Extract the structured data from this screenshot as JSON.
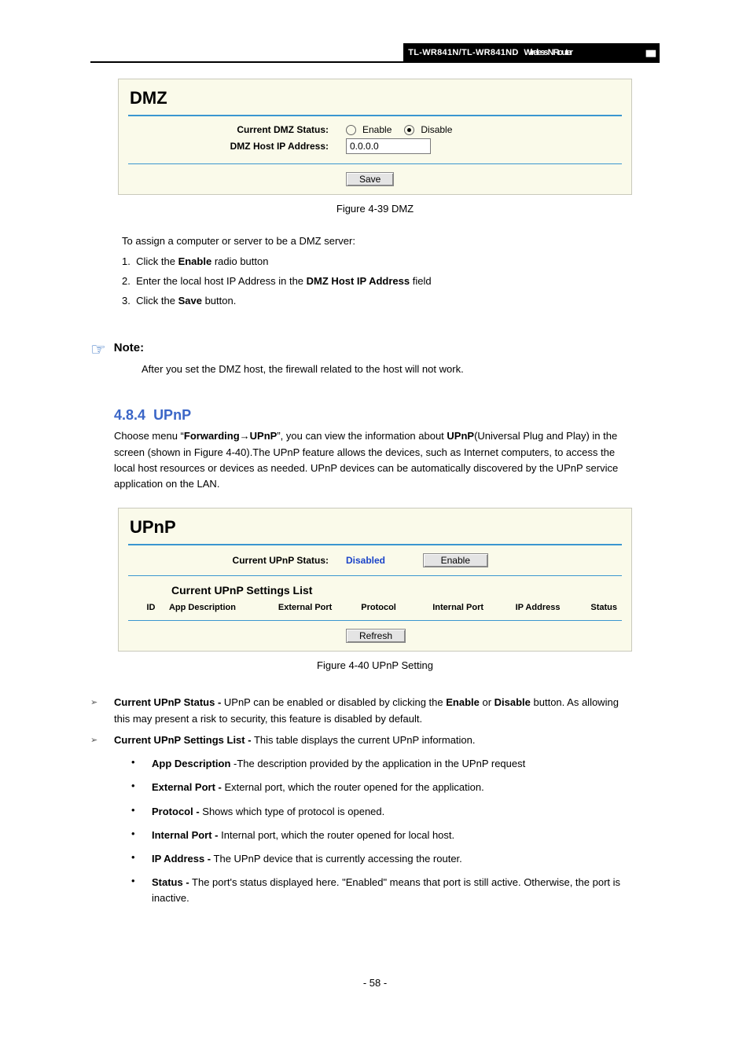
{
  "topbar": {
    "model": "TL-WR841N/TL-WR841ND",
    "desc": "Wireless N Router",
    "bars": "▮▮▮"
  },
  "dmz_panel": {
    "title": "DMZ",
    "status_label": "Current DMZ Status:",
    "enable": "Enable",
    "disable": "Disable",
    "ip_label": "DMZ Host IP Address:",
    "ip_value": "0.0.0.0",
    "save": "Save"
  },
  "dmz_caption": "Figure 4-39 DMZ",
  "dmz_intro": "To assign a computer or server to be a DMZ server:",
  "dmz_steps": {
    "s1_a": "1.",
    "s1_b": "Click the",
    "s1_c": "Enable",
    "s1_d": "radio button",
    "s2_a": "2.",
    "s2_b": "Enter the local host IP Address in the",
    "s2_c": "DMZ Host IP Address",
    "s2_d": "field",
    "s3_a": "3.",
    "s3_b": "Click the",
    "s3_c": "Save",
    "s3_d": "button."
  },
  "note": {
    "label": "Note:",
    "text": "After you set the DMZ host, the firewall related to the host will not work."
  },
  "upnp_section": {
    "num": "4.8.4",
    "title": "UPnP",
    "p1a": "Choose menu “",
    "p1b": "Forwarding→UPnP",
    "p1c": "”, you can view the information about",
    "p1d": "UPnP",
    "p1e": "(Universal Plug",
    "p2": "and Play) in the screen (shown in Figure 4-40).The UPnP feature allows the devices, such as Internet computers, to access the local host resources or devices as needed. UPnP devices can be automatically discovered by the UPnP service application on the LAN."
  },
  "upnp_panel": {
    "title": "UPnP",
    "status_label": "Current UPnP Status:",
    "status_value": "Disabled",
    "enable_btn": "Enable",
    "list_title": "Current UPnP Settings List",
    "cols": {
      "id": "ID",
      "app": "App Description",
      "ext": "External Port",
      "proto": "Protocol",
      "int": "Internal Port",
      "ip": "IP Address",
      "status": "Status"
    },
    "refresh": "Refresh"
  },
  "upnp_caption": "Figure 4-40 UPnP Setting",
  "upnp_list": {
    "a1_lead": "Current UPnP Status -",
    "a1_rest_a": " UPnP can be enabled or disabled by clicking the ",
    "a1_enable": "Enable",
    "a1_or": " or ",
    "a1_disable": "Disable",
    "a1_rest_b": " button. As allowing this may present a risk to security, this feature is disabled by default.",
    "a2_lead": "Current UPnP Settings List -",
    "a2_rest": " This table displays the current UPnP information.",
    "s1_lead": "App Description",
    "s1_rest": " -The description provided by the application in the UPnP request",
    "s2_lead": "External Port -",
    "s2_rest": " External port, which the router opened for the application.",
    "s3_lead": "Protocol -",
    "s3_rest": " Shows which type of protocol is opened.",
    "s4_lead": "Internal Port -",
    "s4_rest": " Internal port, which the router opened for local host.",
    "s5_lead": "IP Address -",
    "s5_rest": " The UPnP device that is currently accessing the router.",
    "s6_lead": "Status -",
    "s6_rest_a": " The port's status displayed here. \"Enabled\" means that port is still active. Otherwise, the port is inactive."
  },
  "page_number": "- 58 -"
}
